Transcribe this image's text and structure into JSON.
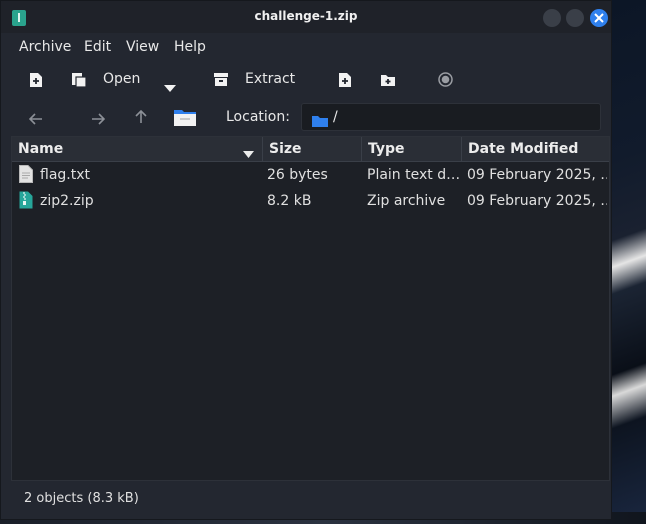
{
  "window": {
    "title": "challenge-1.zip",
    "accent_color": "#2f80ed"
  },
  "menu": {
    "archive": "Archive",
    "edit": "Edit",
    "view": "View",
    "help": "Help"
  },
  "toolbar": {
    "new_icon": "new-archive-icon",
    "open_icon": "open-archive-icon",
    "open_label": "Open",
    "dropdown_icon": "chevron-down-icon",
    "extract_icon": "extract-icon",
    "extract_label": "Extract",
    "add_files_icon": "add-files-icon",
    "add_folder_icon": "add-folder-icon",
    "stop_icon": "stop-icon"
  },
  "location": {
    "label": "Location:",
    "path": "/"
  },
  "columns": {
    "name": "Name",
    "size": "Size",
    "type": "Type",
    "date": "Date Modified"
  },
  "files": [
    {
      "name": "flag.txt",
      "size": "26 bytes",
      "type": "Plain text d…",
      "date": "09 February 2025, …",
      "icon": "text-file-icon"
    },
    {
      "name": "zip2.zip",
      "size": "8.2 kB",
      "type": "Zip archive",
      "date": "09 February 2025, …",
      "icon": "zip-file-icon"
    }
  ],
  "status": {
    "text": "2 objects (8.3 kB)"
  }
}
